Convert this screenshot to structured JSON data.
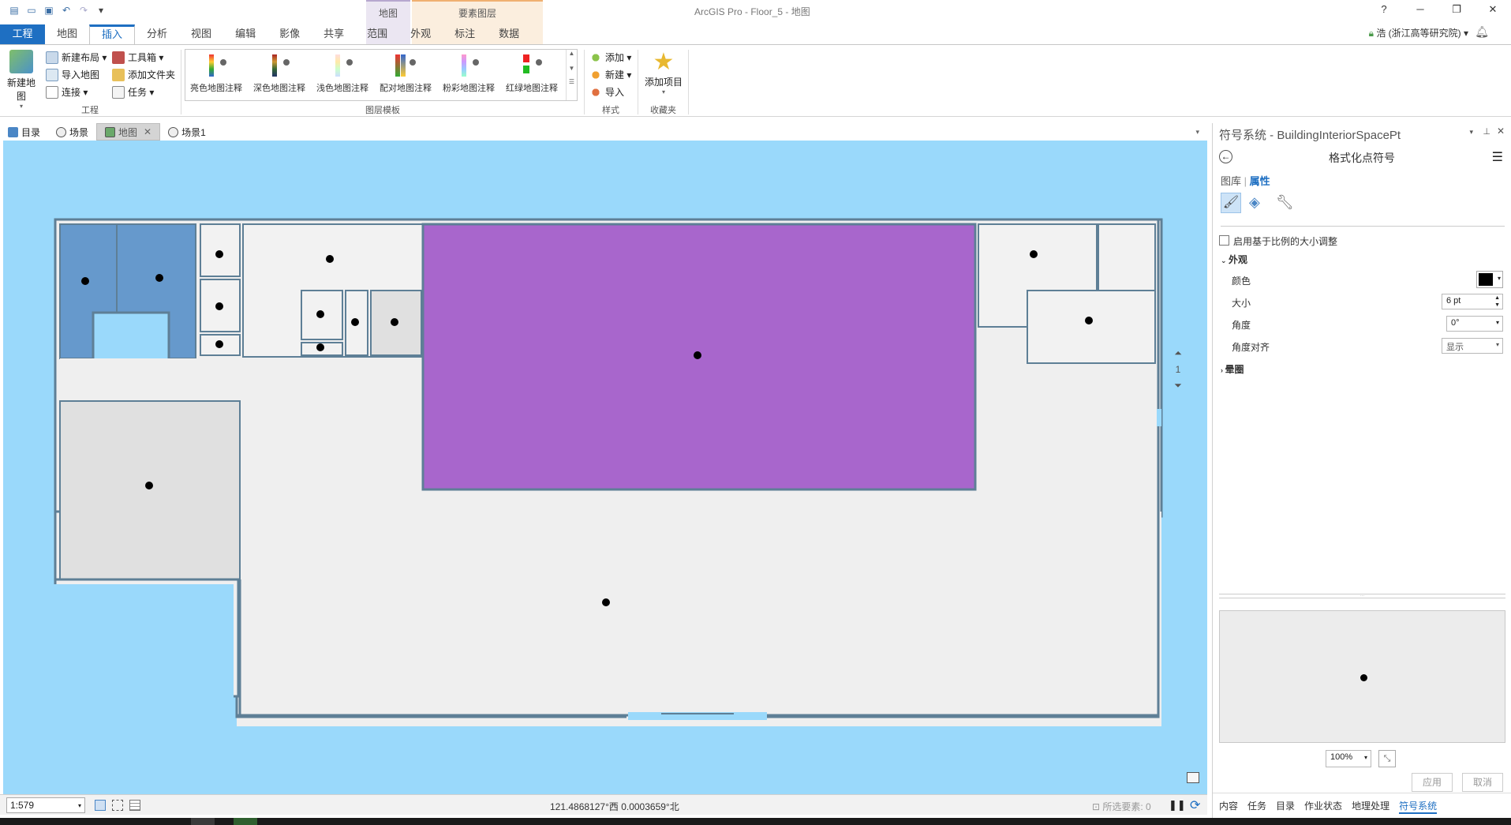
{
  "app": {
    "title": "ArcGIS Pro - Floor_5 - 地图",
    "ctx_map": "地图",
    "ctx_feature": "要素图层",
    "help": "?",
    "user": "浩 (浙江高等研究院) ▾"
  },
  "tabs": [
    "工程",
    "地图",
    "插入",
    "分析",
    "视图",
    "编辑",
    "影像",
    "共享",
    "范围",
    "外观",
    "标注",
    "数据"
  ],
  "active_tab": "插入",
  "ribbon": {
    "new_map": "新建地图",
    "new_layout": "新建布局 ▾",
    "import_map": "导入地图",
    "connect": "连接 ▾",
    "toolbox": "工具箱 ▾",
    "add_folder": "添加文件夹",
    "task": "任务 ▾",
    "group_project": "工程",
    "gallery": [
      "亮色地图注释",
      "深色地图注释",
      "浅色地图注释",
      "配对地图注释",
      "粉彩地图注释",
      "红绿地图注释"
    ],
    "group_templates": "图层模板",
    "add": "添加 ▾",
    "new": "新建 ▾",
    "import": "导入",
    "group_styles": "样式",
    "add_item": "添加项目",
    "group_favorites": "收藏夹"
  },
  "view_tabs": [
    "目录",
    "场景",
    "地图",
    "场景1"
  ],
  "active_view": "地图",
  "map": {
    "colors": {
      "water": "#9ad9fb",
      "room": "#efefef",
      "grey_room": "#e0e0e0",
      "blue_room": "#6699cc",
      "purple_room": "#a866cc",
      "wall": "#5e7f96"
    }
  },
  "page_control": {
    "page": "1"
  },
  "status": {
    "scale": "1:579",
    "coords": "121.4868127°西 0.0003659°北",
    "selected": "所选要素: 0"
  },
  "pane": {
    "title": "符号系统 - BuildingInteriorSpacePt",
    "subtitle": "格式化点符号",
    "tab_gallery": "图库",
    "tab_props": "属性",
    "scale_check": "启用基于比例的大小调整",
    "section_appearance": "外观",
    "color_label": "颜色",
    "size_label": "大小",
    "size_value": "6 pt",
    "angle_label": "角度",
    "angle_value": "0°",
    "angle_align_label": "角度对齐",
    "angle_align_value": "显示",
    "section_halo": "晕圈",
    "zoom": "100%",
    "apply": "应用",
    "cancel": "取消",
    "bottom_tabs": [
      "内容",
      "任务",
      "目录",
      "作业状态",
      "地理处理",
      "符号系统"
    ],
    "active_bottom": "符号系统"
  }
}
